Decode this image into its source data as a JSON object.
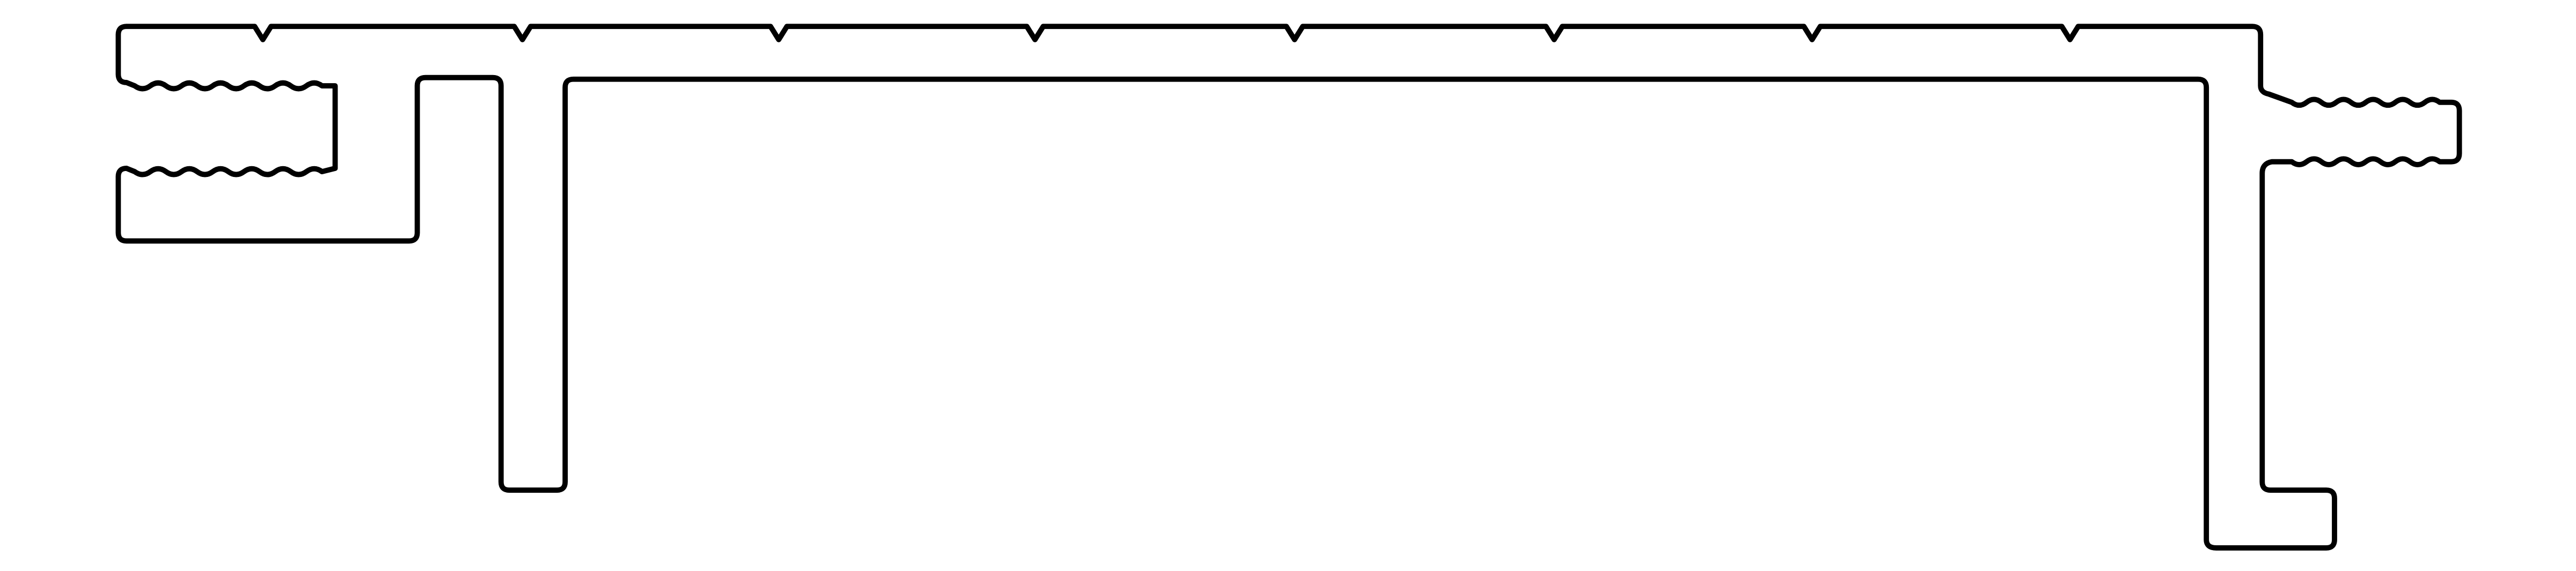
{
  "drawing": {
    "background_color": "#ffffff",
    "line_color": "#000000",
    "parts": [
      {
        "name": "top-deck-surface",
        "notch_count": 8
      },
      {
        "name": "left-tongue-upper-lip",
        "serration_count": 5
      },
      {
        "name": "left-tongue-lower-lip",
        "serration_count": 5
      },
      {
        "name": "left-support-leg"
      },
      {
        "name": "right-end-leg"
      },
      {
        "name": "right-groove-upper-lip",
        "serration_count": 5
      },
      {
        "name": "right-groove-lower-lip",
        "serration_count": 5
      },
      {
        "name": "right-return-foot"
      }
    ]
  }
}
